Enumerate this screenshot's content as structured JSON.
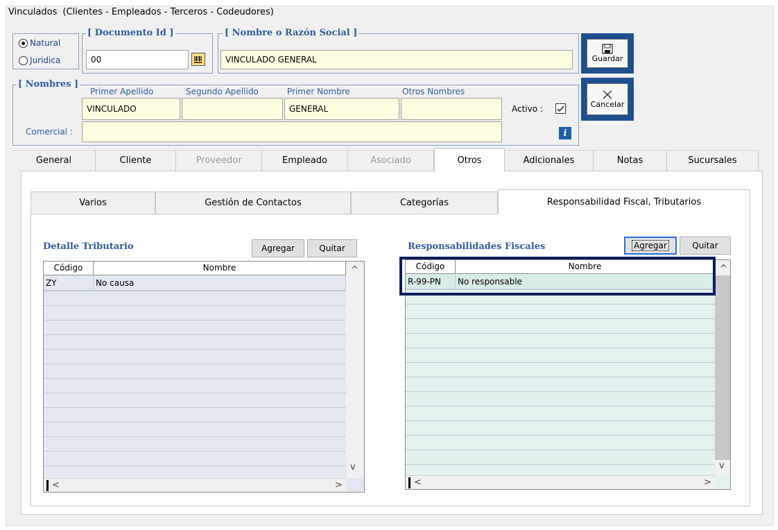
{
  "window": {
    "title": "Vinculados",
    "subtitle": "(Clientes - Empleados - Terceros - Codeudores)"
  },
  "person_type": {
    "options": [
      {
        "label": "Natural",
        "selected": true
      },
      {
        "label": "Juridica",
        "selected": false
      }
    ]
  },
  "documento": {
    "group_label": "[ Documento Id ]",
    "value": "00",
    "icon": "barcode-icon"
  },
  "razon_social": {
    "group_label": "[ Nombre o Razón Social ]",
    "value": "VINCULADO GENERAL"
  },
  "nombres": {
    "group_label": "[ Nombres ]",
    "primer_apellido_label": "Primer Apellido",
    "primer_apellido": "VINCULADO",
    "segundo_apellido_label": "Segundo Apellido",
    "segundo_apellido": "",
    "primer_nombre_label": "Primer Nombre",
    "primer_nombre": "GENERAL",
    "otros_nombres_label": "Otros Nombres",
    "otros_nombres": "",
    "activo_label": "Activo :",
    "activo_checked": true,
    "comercial_label": "Comercial :",
    "comercial": "",
    "info_icon": "info-icon"
  },
  "actions": {
    "guardar": "Guardar",
    "cancelar": "Cancelar",
    "guardar_icon": "floppy-disk-icon",
    "cancelar_icon": "cancel-x-icon"
  },
  "tabs": [
    {
      "label": "General",
      "state": "normal"
    },
    {
      "label": "Cliente",
      "state": "normal"
    },
    {
      "label": "Proveedor",
      "state": "disabled"
    },
    {
      "label": "Empleado",
      "state": "normal"
    },
    {
      "label": "Asociado",
      "state": "disabled"
    },
    {
      "label": "Otros",
      "state": "active"
    },
    {
      "label": "Adicionales",
      "state": "normal"
    },
    {
      "label": "Notas",
      "state": "normal"
    },
    {
      "label": "Sucursales",
      "state": "normal"
    }
  ],
  "subtabs": [
    {
      "label": "Varios",
      "active": false
    },
    {
      "label": "Gestión de Contactos",
      "active": false
    },
    {
      "label": "Categorías",
      "active": false
    },
    {
      "label": "Responsabilidad Fiscal, Tributarios",
      "active": true
    }
  ],
  "detalle": {
    "title": "Detalle Tributario",
    "agregar": "Agregar",
    "quitar": "Quitar",
    "columns": [
      "Código",
      "Nombre"
    ],
    "rows": [
      {
        "codigo": "ZY",
        "nombre": "No causa"
      }
    ]
  },
  "responsabilidades": {
    "title": "Responsabilidades Fiscales",
    "agregar": "Agregar",
    "quitar": "Quitar",
    "columns": [
      "Código",
      "Nombre"
    ],
    "rows": [
      {
        "codigo": "R-99-PN",
        "nombre": "No responsable"
      }
    ]
  },
  "colors": {
    "accent": "#2f5e9e",
    "input_bg": "#ffffe1",
    "grid_left_bg": "#e3e8f0",
    "grid_right_bg": "#e4f1ee",
    "highlight": "#0c1f5c"
  }
}
